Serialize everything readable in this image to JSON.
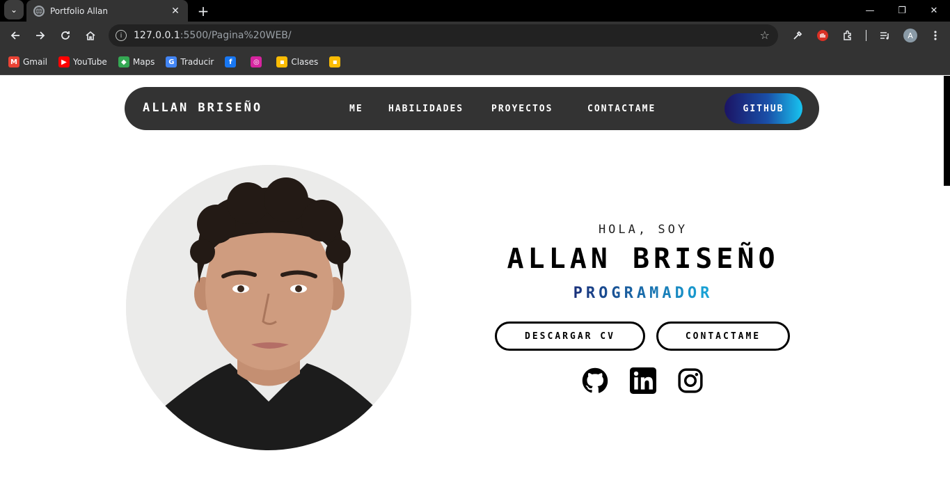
{
  "browser": {
    "tab_title": "Portfolio Allan",
    "url_host": "127.0.0.1",
    "url_path": ":5500/Pagina%20WEB/",
    "profile_initial": "A",
    "bookmarks": [
      {
        "label": "Gmail",
        "icon": "gmail-icon",
        "color": "#ea4335",
        "glyph": "M"
      },
      {
        "label": "YouTube",
        "icon": "youtube-icon",
        "color": "#ff0000",
        "glyph": "▶"
      },
      {
        "label": "Maps",
        "icon": "maps-icon",
        "color": "#34a853",
        "glyph": "◆"
      },
      {
        "label": "Traducir",
        "icon": "translate-icon",
        "color": "#4285f4",
        "glyph": "G"
      },
      {
        "label": "",
        "icon": "facebook-icon",
        "color": "#1877f2",
        "glyph": "f"
      },
      {
        "label": "",
        "icon": "instagram-icon",
        "color": "#d6249f",
        "glyph": "◎"
      },
      {
        "label": "Clases",
        "icon": "classroom-icon",
        "color": "#fbbc04",
        "glyph": "▪"
      },
      {
        "label": "",
        "icon": "classroom-icon",
        "color": "#fbbc04",
        "glyph": "▪"
      }
    ]
  },
  "navbar": {
    "brand": "Allan Briseño",
    "links": [
      "Me",
      "Habilidades",
      "Proyectos",
      "Contactame"
    ],
    "github_label": "Github",
    "gradient": [
      "#1b1464",
      "#18c4f0"
    ]
  },
  "hero": {
    "greeting": "Hola, soy",
    "name": "Allan Briseño",
    "role": "Programador",
    "buttons": {
      "download_cv": "Descargar CV",
      "contact": "Contactame"
    },
    "social_icons": [
      "github-icon",
      "linkedin-icon",
      "instagram-icon"
    ]
  }
}
